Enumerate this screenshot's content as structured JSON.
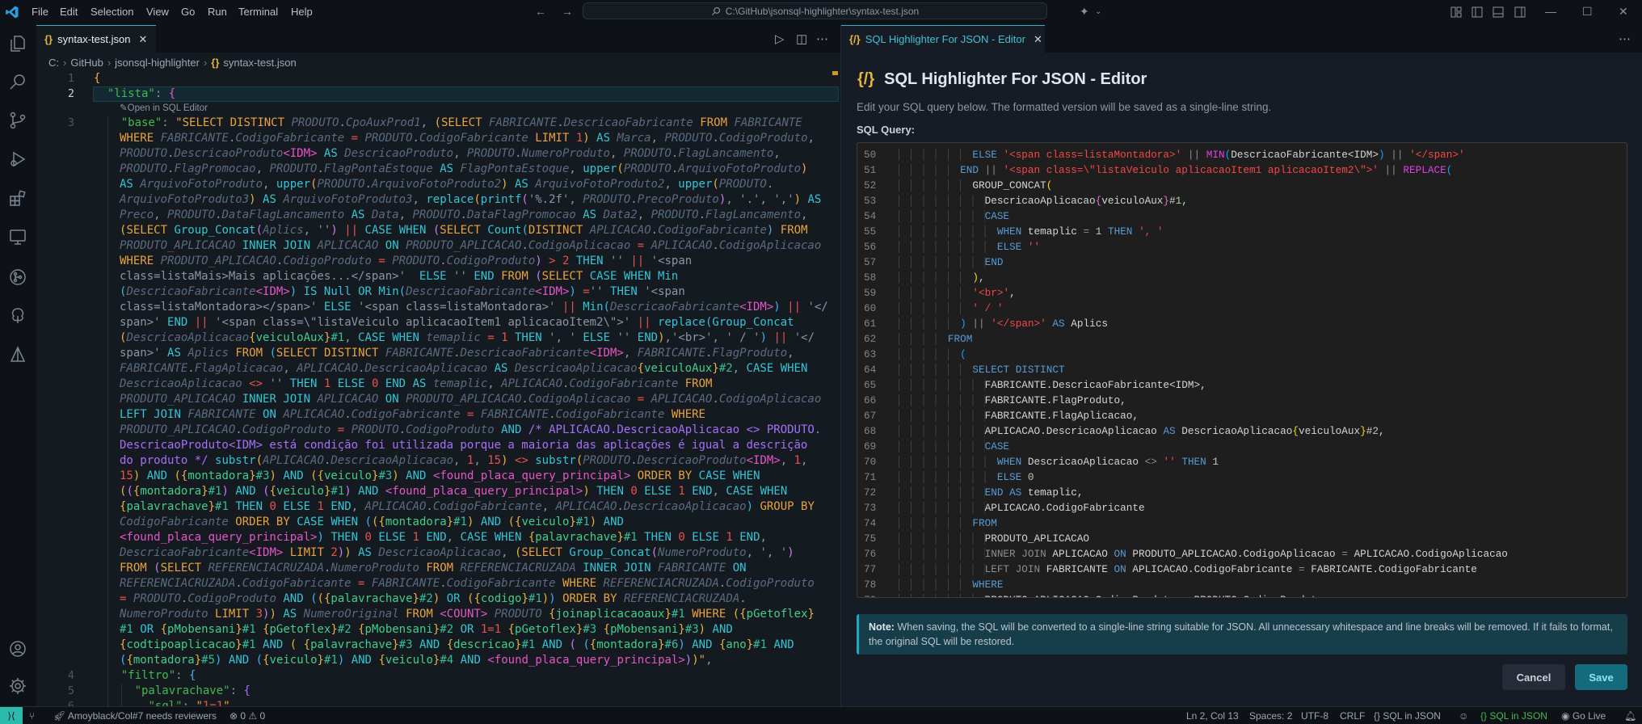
{
  "titlebar": {
    "menu": [
      "File",
      "Edit",
      "Selection",
      "View",
      "Go",
      "Run",
      "Terminal",
      "Help"
    ],
    "search": "C:\\GitHub\\jsonsql-highlighter\\syntax-test.json"
  },
  "left_editor": {
    "tab": "syntax-test.json",
    "breadcrumb": [
      "C:",
      "GitHub",
      "jsonsql-highlighter",
      "syntax-test.json"
    ],
    "codelens": "Open in SQL Editor",
    "lines": [
      {
        "n": "1",
        "rows": [
          "{"
        ]
      },
      {
        "n": "2",
        "rows": [
          "  \"lista\": {"
        ]
      },
      {
        "n": "3",
        "rows": [
          "    \"base\": \"SELECT DISTINCT PRODUTO.CpoAuxProd1, (SELECT FABRICANTE.DescricaoFabricante FROM FABRICANTE",
          "WHERE FABRICANTE.CodigoFabricante = PRODUTO.CodigoFabricante LIMIT 1) AS Marca, PRODUTO.CodigoProduto,",
          "PRODUTO.DescricaoProduto<IDM> AS DescricaoProduto, PRODUTO.NumeroProduto, PRODUTO.FlagLancamento,",
          "PRODUTO.FlagPromocao, PRODUTO.FlagPontaEstoque AS FlagPontaEstoque, upper(PRODUTO.ArquivoFotoProduto)",
          "AS ArquivoFotoProduto, upper(PRODUTO.ArquivoFotoProduto2) AS ArquivoFotoProduto2, upper(PRODUTO.",
          "ArquivoFotoProduto3) AS ArquivoFotoProduto3, replace(printf('%.2f', PRODUTO.PrecoProduto), '.', ',') AS",
          "Preco, PRODUTO.DataFlagLancamento AS Data, PRODUTO.DataFlagPromocao AS Data2, PRODUTO.FlagLancamento,",
          "(SELECT Group_Concat(Aplics, '') || CASE WHEN (SELECT Count(DISTINCT APLICACAO.CodigoFabricante) FROM",
          "PRODUTO_APLICACAO INNER JOIN APLICACAO ON PRODUTO_APLICACAO.CodigoAplicacao = APLICACAO.CodigoAplicacao",
          "WHERE PRODUTO_APLICACAO.CodigoProduto = PRODUTO.CodigoProduto) > 2 THEN '' || '<span",
          "class=listaMais>Mais aplicações...</span>'  ELSE '' END FROM (SELECT CASE WHEN Min",
          "(DescricaoFabricante<IDM>) IS Null OR Min(DescricaoFabricante<IDM>) ='' THEN '<span",
          "class=listaMontadora></span>' ELSE '<span class=listaMontadora>' || Min(DescricaoFabricante<IDM>) || '</",
          "span>' END || '<span class=\\\"listaVeiculo aplicacaoItem1 aplicacaoItem2\\\">' || replace(Group_Concat",
          "(DescricaoAplicacao{veiculoAux}#1, CASE WHEN temaplic = 1 THEN ', ' ELSE '' END),'<br>', ' / ') || '</",
          "span>' AS Aplics FROM (SELECT DISTINCT FABRICANTE.DescricaoFabricante<IDM>, FABRICANTE.FlagProduto,",
          "FABRICANTE.FlagAplicacao, APLICACAO.DescricaoAplicacao AS DescricaoAplicacao{veiculoAux}#2, CASE WHEN",
          "DescricaoAplicacao <> '' THEN 1 ELSE 0 END AS temaplic, APLICACAO.CodigoFabricante FROM",
          "PRODUTO_APLICACAO INNER JOIN APLICACAO ON PRODUTO_APLICACAO.CodigoAplicacao = APLICACAO.CodigoAplicacao",
          "LEFT JOIN FABRICANTE ON APLICACAO.CodigoFabricante = FABRICANTE.CodigoFabricante WHERE",
          "PRODUTO_APLICACAO.CodigoProduto = PRODUTO.CodigoProduto AND /* APLICACAO.DescricaoAplicacao <> PRODUTO.",
          "DescricaoProduto<IDM> está condição foi utilizada porque a maioria das aplicações é igual a descrição",
          "do produto */ substr(APLICACAO.DescricaoAplicacao, 1, 15) <> substr(PRODUTO.DescricaoProduto<IDM>, 1,",
          "15) AND ({montadora}#3) AND ({veiculo}#3) AND <found_placa_query_principal> ORDER BY CASE WHEN",
          "(({montadora}#1) AND ({veiculo}#1) AND <found_placa_query_principal>) THEN 0 ELSE 1 END, CASE WHEN",
          "{palavrachave}#1 THEN 0 ELSE 1 END, APLICACAO.CodigoFabricante, APLICACAO.DescricaoAplicacao) GROUP BY",
          "CodigoFabricante ORDER BY CASE WHEN (({montadora}#1) AND ({veiculo}#1) AND",
          "<found_placa_query_principal>) THEN 0 ELSE 1 END, CASE WHEN {palavrachave}#1 THEN 0 ELSE 1 END,",
          "DescricaoFabricante<IDM> LIMIT 2)) AS DescricaoAplicacao, (SELECT Group_Concat(NumeroProduto, ', ')",
          "FROM (SELECT REFERENCIACRUZADA.NumeroProduto FROM REFERENCIACRUZADA INNER JOIN FABRICANTE ON",
          "REFERENCIACRUZADA.CodigoFabricante = FABRICANTE.CodigoFabricante WHERE REFERENCIACRUZADA.CodigoProduto",
          "= PRODUTO.CodigoProduto AND (({palavrachave}#2) OR ({codigo}#1)) ORDER BY REFERENCIACRUZADA.",
          "NumeroProduto LIMIT 3)) AS NumeroOriginal FROM <COUNT> PRODUTO {joinaplicacaoaux}#1 WHERE ({pGetoflex}",
          "#1 OR {pMobensani}#1 {pGetoflex}#2 {pMobensani}#2 OR 1=1 {pGetoflex}#3 {pMobensani}#3) AND",
          "{codtipoaplicacao}#1 AND ( {palavrachave}#3 AND {descricao}#1 AND ( ({montadora}#6) AND {ano}#1 AND",
          "({montadora}#5) AND ({veiculo}#1) AND {veiculo}#4 AND <found_placa_query_principal>))\","
        ]
      },
      {
        "n": "4",
        "rows": [
          "    \"filtro\": {"
        ]
      },
      {
        "n": "5",
        "rows": [
          "      \"palavrachave\": {"
        ]
      },
      {
        "n": "6",
        "rows": [
          "        \"sql\": \"1=1\""
        ]
      }
    ]
  },
  "right_panel": {
    "tab": "SQL Highlighter For JSON - Editor",
    "title": "SQL Highlighter For JSON - Editor",
    "description": "Edit your SQL query below. The formatted version will be saved as a single-line string.",
    "label": "SQL Query:",
    "code": [
      {
        "n": "50",
        "text": "            ELSE '<span class=listaMontadora>' || MIN(DescricaoFabricante<IDM>) || '</span>'"
      },
      {
        "n": "51",
        "text": "          END || '<span class=\\\"listaVeiculo aplicacaoItem1 aplicacaoItem2\\\">' || REPLACE("
      },
      {
        "n": "52",
        "text": "            GROUP_CONCAT("
      },
      {
        "n": "53",
        "text": "              DescricaoAplicacao{veiculoAux}#1,"
      },
      {
        "n": "54",
        "text": "              CASE"
      },
      {
        "n": "55",
        "text": "                WHEN temaplic = 1 THEN ', '"
      },
      {
        "n": "56",
        "text": "                ELSE ''"
      },
      {
        "n": "57",
        "text": "              END"
      },
      {
        "n": "58",
        "text": "            ),"
      },
      {
        "n": "59",
        "text": "            '<br>',"
      },
      {
        "n": "60",
        "text": "            ' / '"
      },
      {
        "n": "61",
        "text": "          ) || '</span>' AS Aplics"
      },
      {
        "n": "62",
        "text": "        FROM"
      },
      {
        "n": "63",
        "text": "          ("
      },
      {
        "n": "64",
        "text": "            SELECT DISTINCT"
      },
      {
        "n": "65",
        "text": "              FABRICANTE.DescricaoFabricante<IDM>,"
      },
      {
        "n": "66",
        "text": "              FABRICANTE.FlagProduto,"
      },
      {
        "n": "67",
        "text": "              FABRICANTE.FlagAplicacao,"
      },
      {
        "n": "68",
        "text": "              APLICACAO.DescricaoAplicacao AS DescricaoAplicacao{veiculoAux}#2,"
      },
      {
        "n": "69",
        "text": "              CASE"
      },
      {
        "n": "70",
        "text": "                WHEN DescricaoAplicacao <> '' THEN 1"
      },
      {
        "n": "71",
        "text": "                ELSE 0"
      },
      {
        "n": "72",
        "text": "              END AS temaplic,"
      },
      {
        "n": "73",
        "text": "              APLICACAO.CodigoFabricante"
      },
      {
        "n": "74",
        "text": "            FROM"
      },
      {
        "n": "75",
        "text": "              PRODUTO_APLICACAO"
      },
      {
        "n": "76",
        "text": "              INNER JOIN APLICACAO ON PRODUTO_APLICACAO.CodigoAplicacao = APLICACAO.CodigoAplicacao"
      },
      {
        "n": "77",
        "text": "              LEFT JOIN FABRICANTE ON APLICACAO.CodigoFabricante = FABRICANTE.CodigoFabricante"
      },
      {
        "n": "78",
        "text": "            WHERE"
      },
      {
        "n": "79",
        "text": "              PRODUTO_APLICACAO.CodigoProduto = PRODUTO.CodigoProduto"
      }
    ],
    "note_label": "Note:",
    "note": "When saving, the SQL will be converted to a single-line string suitable for JSON. All unnecessary whitespace and line breaks will be removed. If it fails to format, the original SQL will be restored.",
    "cancel": "Cancel",
    "save": "Save"
  },
  "statusbar": {
    "pr": "Amoyblack/Col#7 needs reviewers",
    "errors": "0",
    "warnings": "0",
    "position": "Ln 2, Col 13",
    "spaces": "Spaces: 2",
    "encoding": "UTF-8",
    "eol": "CRLF",
    "language": "SQL in JSON",
    "extension": "SQL in JSON",
    "golive": "Go Live"
  },
  "colors": {
    "accent": "#2bb5c9",
    "save": "#136b7c",
    "remote": "#2bbbad",
    "extension_status": "#3fb950"
  }
}
